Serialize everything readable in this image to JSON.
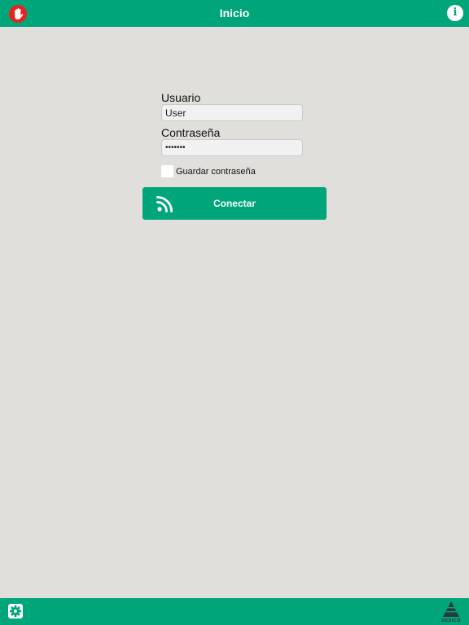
{
  "header": {
    "title": "Inicio",
    "stop_icon": "hand-stop-icon",
    "info_icon": "info-icon",
    "info_glyph": "i"
  },
  "login": {
    "user_label": "Usuario",
    "user_value": "User",
    "password_label": "Contraseña",
    "password_value": "•••••••",
    "remember_label": "Guardar contraseña",
    "remember_checked": false,
    "connect_label": "Conectar",
    "connect_icon": "rss-icon"
  },
  "footer": {
    "settings_icon": "gear-icon",
    "logo_text": "DESICO"
  },
  "colors": {
    "primary": "#00a57a",
    "background": "#e1dfdb",
    "stop_red": "#e8231f"
  }
}
